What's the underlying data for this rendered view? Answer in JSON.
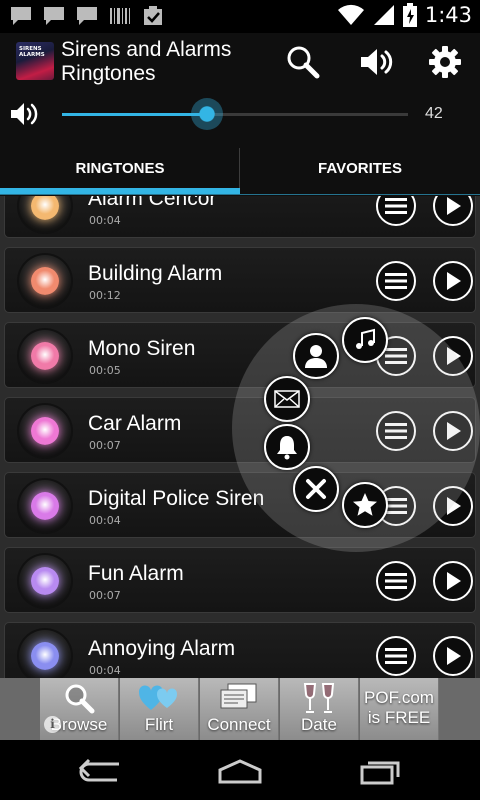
{
  "status_bar": {
    "time": "1:43",
    "left_icons": [
      "chat-icon",
      "chat-icon",
      "chat-icon",
      "barcode-icon",
      "clipboard-check-icon"
    ],
    "right_icons": [
      "wifi-icon",
      "signal-icon",
      "battery-charging-icon"
    ]
  },
  "app_bar": {
    "logo_text": "SIRENS ALARMS",
    "title": "Sirens and Alarms Ringtones",
    "actions": [
      "search-icon",
      "volume-icon",
      "settings-gear-icon"
    ]
  },
  "volume": {
    "value_label": "42",
    "level_fraction": 0.42
  },
  "tabs": [
    {
      "label": "RINGTONES",
      "selected": true
    },
    {
      "label": "FAVORITES",
      "selected": false
    }
  ],
  "ringtones": [
    {
      "title": "Alarm Cencor",
      "duration": "00:04",
      "lamp_color": "#f4b870"
    },
    {
      "title": "Building Alarm",
      "duration": "00:12",
      "lamp_color": "#f08a6e"
    },
    {
      "title": "Mono Siren",
      "duration": "00:05",
      "lamp_color": "#f07aa8"
    },
    {
      "title": "Car Alarm",
      "duration": "00:07",
      "lamp_color": "#ee78d4"
    },
    {
      "title": "Digital Police Siren",
      "duration": "00:04",
      "lamp_color": "#d97ae8"
    },
    {
      "title": "Fun Alarm",
      "duration": "00:07",
      "lamp_color": "#b88af0"
    },
    {
      "title": "Annoying Alarm",
      "duration": "00:04",
      "lamp_color": "#8a8ef0"
    }
  ],
  "radial_menu": [
    "music-note-icon",
    "contact-icon",
    "mail-icon",
    "bell-icon",
    "close-icon",
    "star-icon"
  ],
  "ad_banner": {
    "tiles": [
      {
        "label": "Browse",
        "icon": "magnifier-icon"
      },
      {
        "label": "Flirt",
        "icon": "hearts-icon"
      },
      {
        "label": "Connect",
        "icon": "messages-icon"
      },
      {
        "label": "Date",
        "icon": "wine-glasses-icon"
      }
    ],
    "promo_line1": "POF.com",
    "promo_line2": "is FREE",
    "info_glyph": "i"
  },
  "nav_bar": [
    "back-icon",
    "home-icon",
    "recent-apps-icon"
  ],
  "colors": {
    "accent": "#33b5e5",
    "list_background": "#2c2c2c",
    "bar_background": "#0f0f0f"
  }
}
